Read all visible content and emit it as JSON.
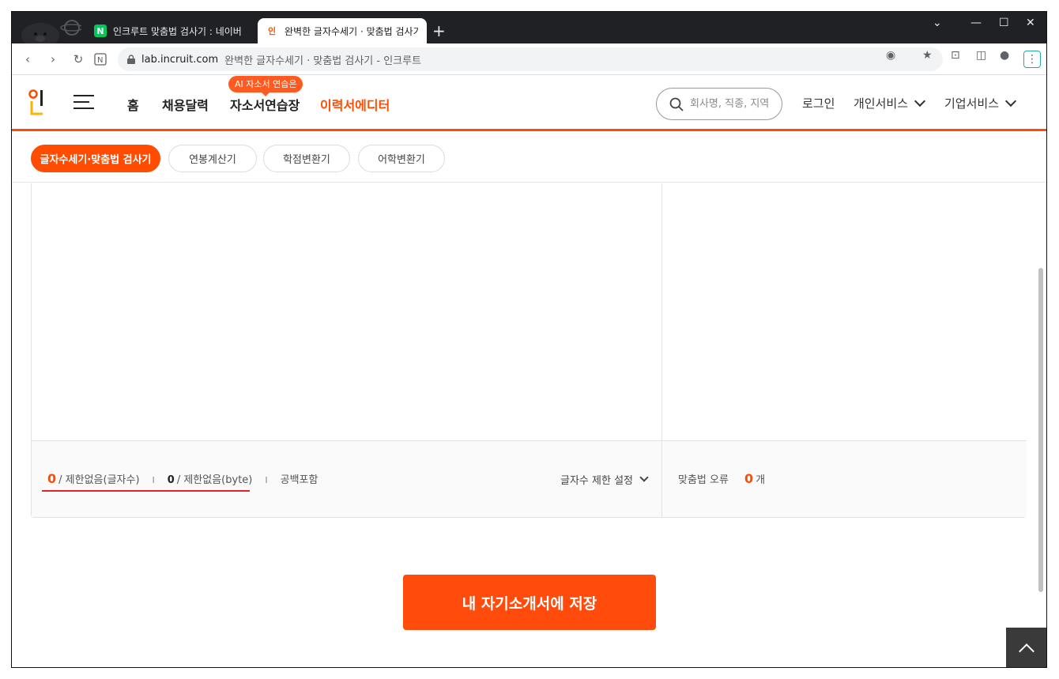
{
  "browser": {
    "tabs": [
      {
        "title": "인크루트 맞춤법 검사기 : 네이버",
        "favicon": "N"
      },
      {
        "title": "완벽한 글자수세기 · 맞춤법 검사기",
        "favicon": "인"
      }
    ],
    "new_tab": "+",
    "url_domain": "lab.incruit.com",
    "url_title": "완벽한 글자수세기 · 맞춤법 검사기 - 인크루트"
  },
  "header": {
    "nav": [
      "홈",
      "채용달력",
      "자소서연습장",
      "이력서에디터"
    ],
    "ai_badge": "AI 자소서 연습은",
    "search_placeholder": "회사명, 직종, 지역",
    "login": "로그인",
    "personal": "개인서비스",
    "business": "기업서비스"
  },
  "subnav": {
    "tabs": [
      "글자수세기·맞춤법 검사기",
      "연봉계산기",
      "학점변환기",
      "어학변환기"
    ]
  },
  "counter": {
    "char_count": "0",
    "char_limit": "/ 제한없음(글자수)",
    "byte_count": "0",
    "byte_limit": "/ 제한없음(byte)",
    "sep": "I",
    "include_space": "공백포함",
    "limit_setting": "글자수 제한 설정"
  },
  "spell": {
    "label": "맞춤법 오류",
    "count": "0",
    "unit": "개"
  },
  "save_button": "내 자기소개서에 저장",
  "colors": {
    "brand": "#ff4c00",
    "underline": "#e8202a"
  }
}
